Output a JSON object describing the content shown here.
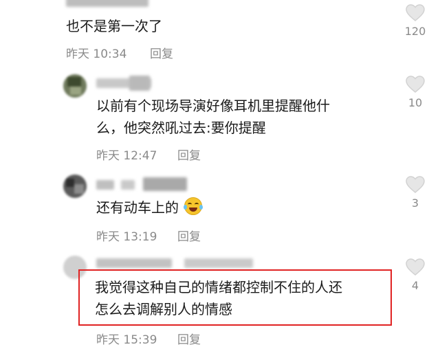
{
  "accent_color": "#e02222",
  "comments": [
    {
      "text_lines": [
        "也不是第一次了"
      ],
      "time": "昨天 10:34",
      "reply_label": "回复",
      "likes": "120"
    },
    {
      "text_lines": [
        "以前有个现场导演好像耳机里提醒他什",
        "么，他突然吼过去:要你提醒"
      ],
      "time": "昨天 12:47",
      "reply_label": "回复",
      "likes": "10"
    },
    {
      "text_lines": [
        "还有动车上的"
      ],
      "emoji": "laughing-crying-emoji",
      "time": "昨天 13:19",
      "reply_label": "回复",
      "likes": "3"
    },
    {
      "text_lines": [
        "我觉得这种自己的情绪都控制不住的人还",
        "怎么去调解别人的情感"
      ],
      "time": "昨天 15:39",
      "reply_label": "回复",
      "likes": "4",
      "highlighted": true
    }
  ],
  "icons": {
    "like": "heart-outline-icon",
    "avatar": "blurred-avatar"
  }
}
